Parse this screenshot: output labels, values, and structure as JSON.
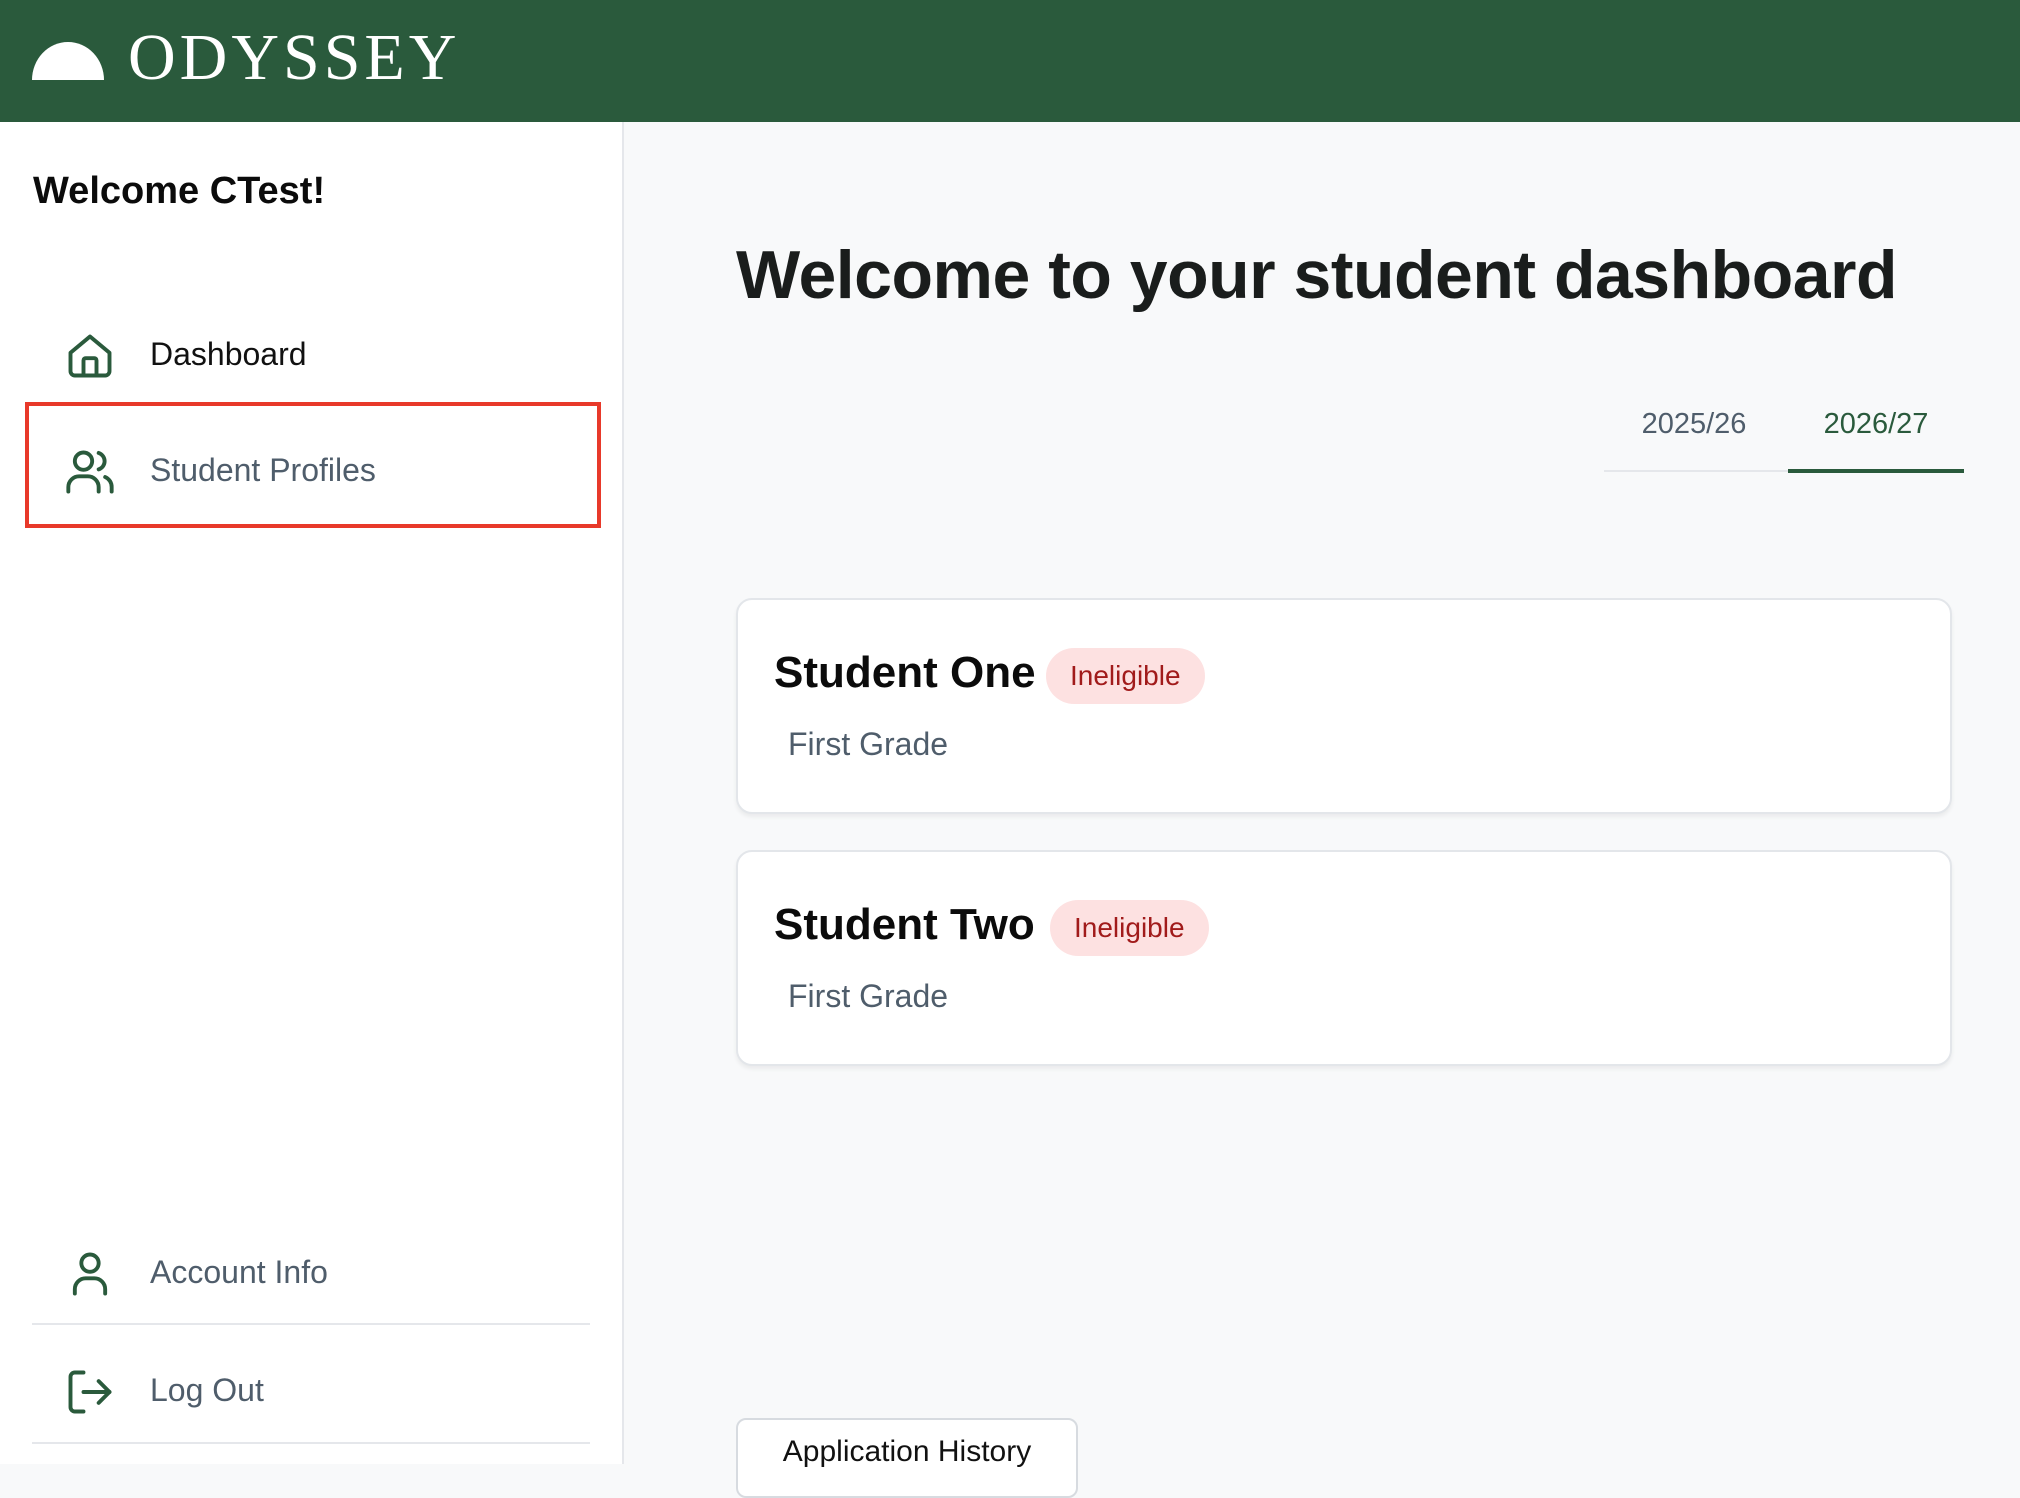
{
  "brand": {
    "name": "ODYSSEY",
    "color": "#2a5a3c"
  },
  "sidebar": {
    "welcome": "Welcome CTest!",
    "items": [
      {
        "label": "Dashboard",
        "icon": "home-icon"
      },
      {
        "label": "Student Profiles",
        "icon": "users-icon",
        "highlighted": true
      },
      {
        "label": "Account Info",
        "icon": "user-icon"
      },
      {
        "label": "Log Out",
        "icon": "logout-icon"
      }
    ]
  },
  "main": {
    "title": "Welcome to your student dashboard",
    "tabs": [
      {
        "label": "2025/26",
        "active": false
      },
      {
        "label": "2026/27",
        "active": true
      }
    ],
    "students": [
      {
        "name": "Student One",
        "status": "Ineligible",
        "grade": "First Grade"
      },
      {
        "name": "Student Two",
        "status": "Ineligible",
        "grade": "First Grade"
      }
    ],
    "history_button": "Application History"
  },
  "colors": {
    "header_bg": "#2a5a3c",
    "highlight_border": "#e8392a",
    "badge_bg": "#fde1e1",
    "badge_text": "#a11b1b"
  }
}
